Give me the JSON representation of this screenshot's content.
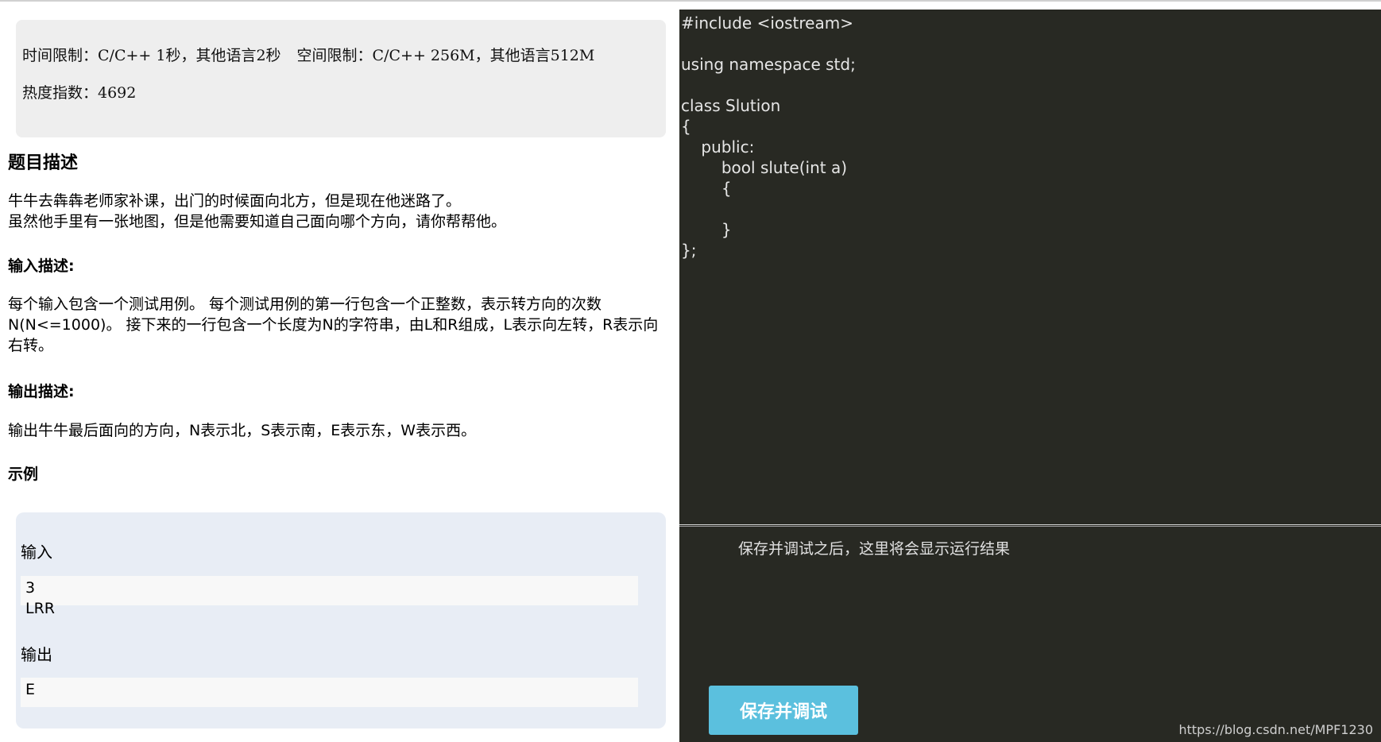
{
  "problem": {
    "limits_time": "时间限制：C/C++ 1秒，其他语言2秒",
    "limits_space": "空间限制：C/C++ 256M，其他语言512M",
    "heat": "热度指数：4692",
    "description_title": "题目描述",
    "description_lines": [
      "牛牛去犇犇老师家补课，出门的时候面向北方，但是现在他迷路了。",
      "虽然他手里有一张地图，但是他需要知道自己面向哪个方向，请你帮帮他。"
    ],
    "input_title": "输入描述:",
    "input_lines": [
      "每个输入包含一个测试用例。 每个测试用例的第一行包含一个正整数，表示转方向的次数",
      "N(N<=1000)。 接下来的一行包含一个长度为N的字符串，由L和R组成，L表示向左转，R表示向",
      "右转。"
    ],
    "output_title": "输出描述:",
    "output_line": "输出牛牛最后面向的方向，N表示北，S表示南，E表示东，W表示西。",
    "example_title": "示例",
    "example": {
      "input_label": "输入",
      "input_lines": [
        "3",
        "LRR"
      ],
      "output_label": "输出",
      "output_value": "E"
    }
  },
  "editor": {
    "code_lines": [
      "#include <iostream>",
      "using namespace std;",
      "class Slution",
      "{",
      "    public:",
      "        bool slute(int a)",
      "        {",
      "        }",
      "};"
    ]
  },
  "result": {
    "placeholder": "保存并调试之后，这里将会显示运行结果"
  },
  "actions": {
    "run_label": "保存并调试"
  },
  "watermark": "https://blog.csdn.net/MPF1230"
}
